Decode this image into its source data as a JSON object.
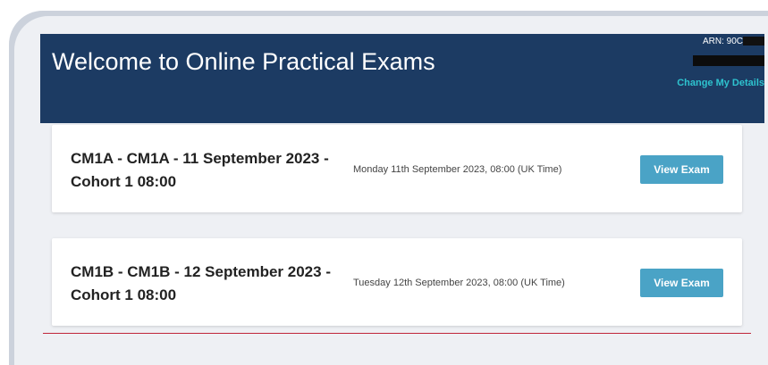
{
  "header": {
    "title": "Welcome to Online Practical Exams",
    "arn_label": "ARN: 90C",
    "change_details": "Change My Details"
  },
  "exams": [
    {
      "title": "CM1A - CM1A - 11 September 2023 - Cohort 1 08:00",
      "date": "Monday 11th September 2023, 08:00 (UK Time)",
      "button": "View Exam"
    },
    {
      "title": "CM1B - CM1B - 12 September 2023 - Cohort 1 08:00",
      "date": "Tuesday 12th September 2023, 08:00 (UK Time)",
      "button": "View Exam"
    }
  ],
  "colors": {
    "header_bg": "#1c3b63",
    "link": "#2ec3cf",
    "button_bg": "#4aa3c6",
    "divider": "#c0263a"
  }
}
